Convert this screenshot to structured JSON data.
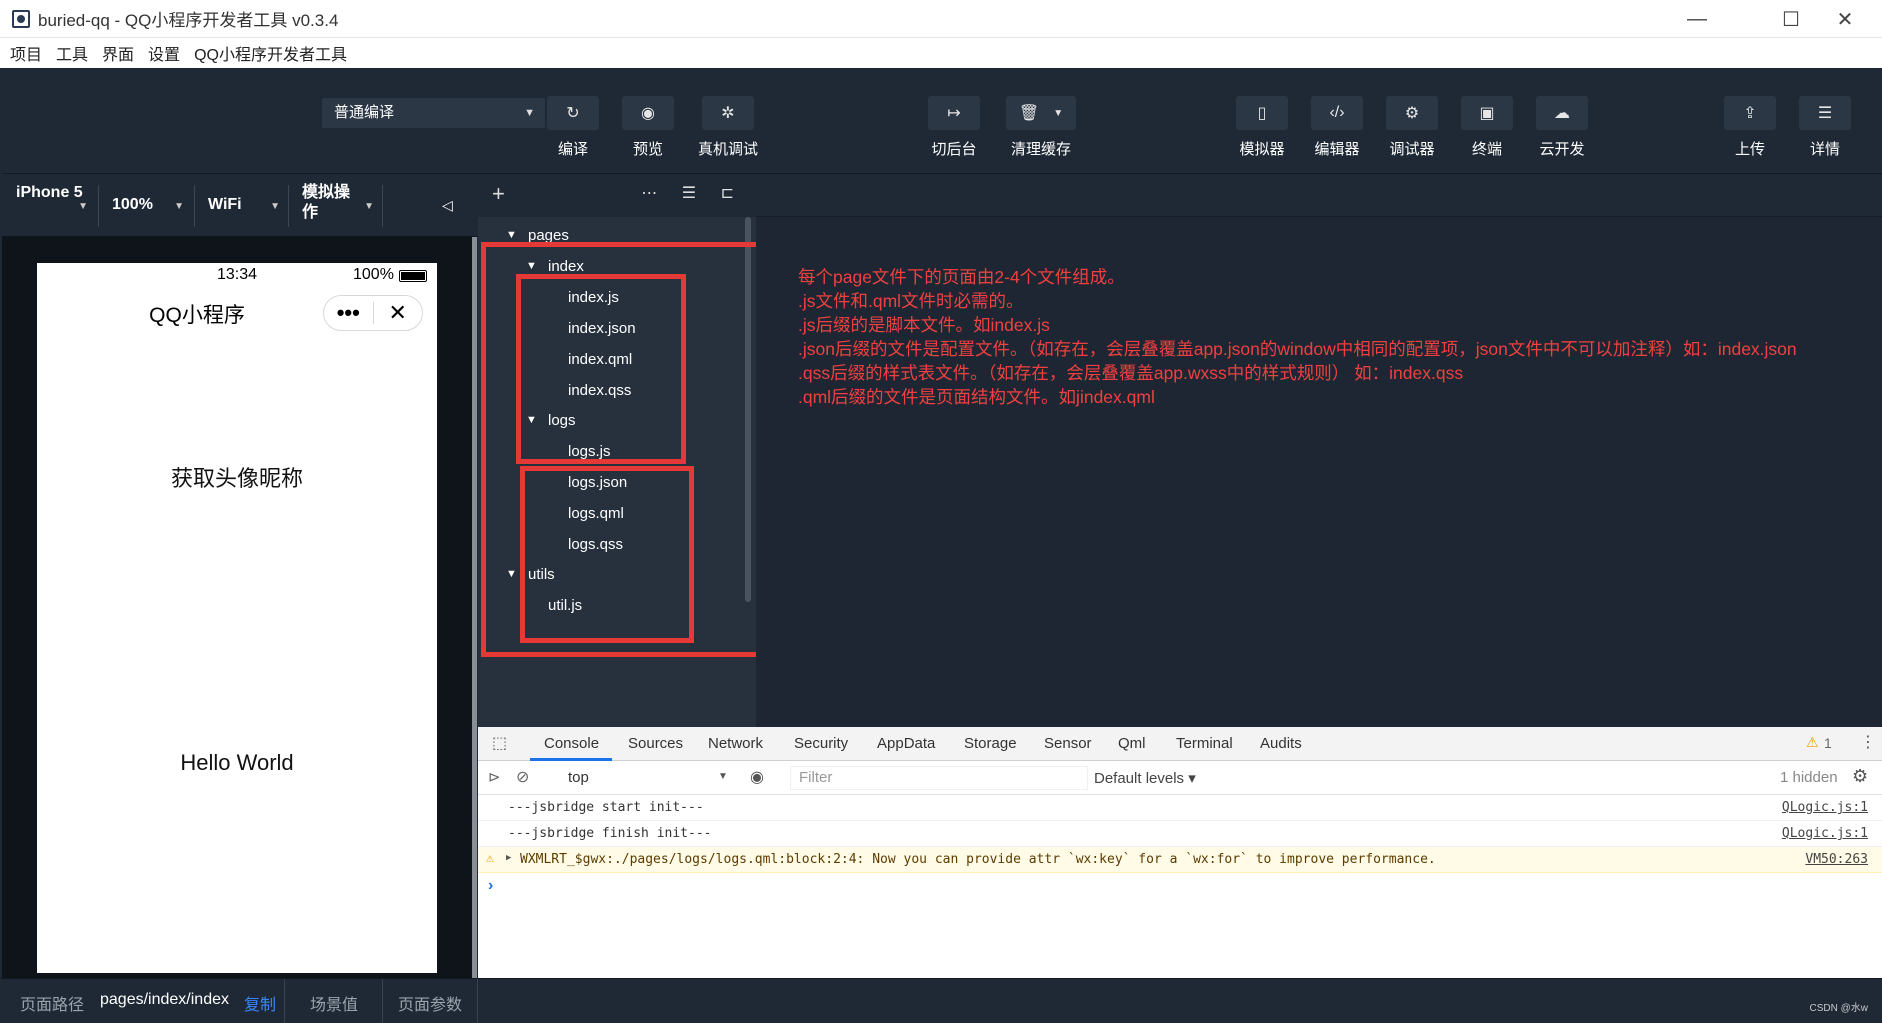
{
  "window": {
    "title": "buried-qq - QQ小程序开发者工具 v0.3.4",
    "controls": {
      "minimize": "—",
      "maximize": "☐",
      "close": "✕"
    }
  },
  "menu": [
    "项目",
    "工具",
    "界面",
    "设置",
    "QQ小程序开发者工具"
  ],
  "toolbar": {
    "compile_mode": "普通编译",
    "buttons": [
      {
        "label": "编译",
        "icon": "refresh-icon",
        "glyph": "↻"
      },
      {
        "label": "预览",
        "icon": "eye-icon",
        "glyph": "◉"
      },
      {
        "label": "真机调试",
        "icon": "bug-icon",
        "glyph": "✲"
      },
      {
        "label": "切后台",
        "icon": "switch-icon",
        "glyph": "↦"
      },
      {
        "label": "清理缓存",
        "icon": "trash-icon",
        "glyph": "🗑"
      },
      {
        "label": "模拟器",
        "icon": "phone-icon",
        "glyph": "▯"
      },
      {
        "label": "编辑器",
        "icon": "code-icon",
        "glyph": "‹/›"
      },
      {
        "label": "调试器",
        "icon": "sliders-icon",
        "glyph": "⚙"
      },
      {
        "label": "终端",
        "icon": "terminal-icon",
        "glyph": "▣"
      },
      {
        "label": "云开发",
        "icon": "cloud-icon",
        "glyph": "☁"
      },
      {
        "label": "上传",
        "icon": "upload-icon",
        "glyph": "⇪"
      },
      {
        "label": "详情",
        "icon": "menu-icon",
        "glyph": "☰"
      }
    ]
  },
  "simulator": {
    "device": "iPhone 5",
    "zoom": "100%",
    "network": "WiFi",
    "operation": "模拟操作",
    "phone": {
      "time": "13:34",
      "battery": "100%",
      "nav_title": "QQ小程序",
      "capsule_more": "•••",
      "capsule_close": "✕",
      "text1": "获取头像昵称",
      "text2": "Hello World"
    }
  },
  "file_tree": {
    "items": [
      {
        "label": "pages",
        "expanded": true
      },
      {
        "label": "index",
        "expanded": true
      },
      {
        "label": "index.js"
      },
      {
        "label": "index.json"
      },
      {
        "label": "index.qml"
      },
      {
        "label": "index.qss"
      },
      {
        "label": "logs",
        "expanded": true
      },
      {
        "label": "logs.js"
      },
      {
        "label": "logs.json"
      },
      {
        "label": "logs.qml"
      },
      {
        "label": "logs.qss"
      },
      {
        "label": "utils",
        "expanded": true
      },
      {
        "label": "util.js"
      }
    ]
  },
  "editor": {
    "notes": [
      "每个page文件下的页面由2-4个文件组成。",
      ".js文件和.qml文件时必需的。",
      ".js后缀的是脚本文件。如index.js",
      ".json后缀的文件是配置文件。（如存在，会层叠覆盖app.json的window中相同的配置项，json文件中不可以加注释）如：index.json",
      ".qss后缀的样式表文件。（如存在，会层叠覆盖app.wxss中的样式规则） 如：index.qss",
      ".qml后缀的文件是页面结构文件。如jindex.qml"
    ]
  },
  "devtools": {
    "tabs": [
      "Console",
      "Sources",
      "Network",
      "Security",
      "AppData",
      "Storage",
      "Sensor",
      "Qml",
      "Terminal",
      "Audits"
    ],
    "active_tab": "Console",
    "warning_count": "1",
    "context": "top",
    "filter_placeholder": "Filter",
    "levels": "Default levels ▾",
    "hidden": "1 hidden",
    "logs": [
      {
        "type": "info",
        "message": "---jsbridge start init---",
        "source": "QLogic.js:1"
      },
      {
        "type": "info",
        "message": "---jsbridge finish init---",
        "source": "QLogic.js:1"
      },
      {
        "type": "warning",
        "message": "WXMLRT_$gwx:./pages/logs/logs.qml:block:2:4: Now you can provide attr `wx:key` for a `wx:for` to improve performance.",
        "source": "VM50:263"
      }
    ]
  },
  "status_bar": {
    "path_label": "页面路径",
    "path_value": "pages/index/index",
    "copy_label": "复制",
    "scene_label": "场景值",
    "params_label": "页面参数",
    "watermark": "CSDN @水w"
  }
}
